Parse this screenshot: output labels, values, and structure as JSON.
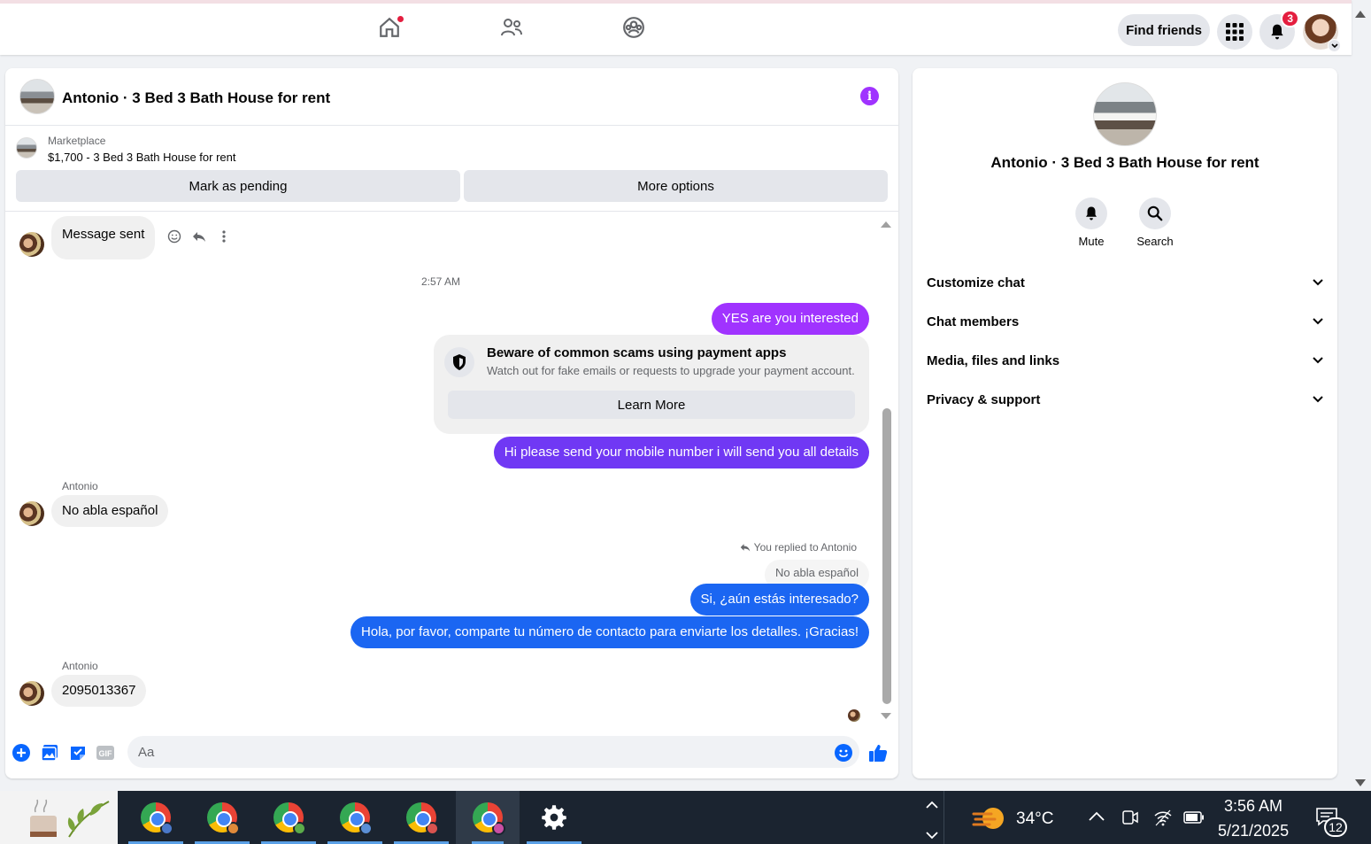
{
  "topnav": {
    "find_friends": "Find friends",
    "notification_count": "3"
  },
  "chat": {
    "title": "Antonio · 3 Bed 3 Bath House for rent",
    "marketplace_label": "Marketplace",
    "listing": "$1,700 - 3 Bed 3 Bath House for rent",
    "mark_pending": "Mark as pending",
    "more_options": "More options",
    "messages": {
      "m1": "Message sent",
      "timestamp": "2:57 AM",
      "m2": "YES are you interested",
      "scam_title": "Beware of common scams using payment apps",
      "scam_sub": "Watch out for fake emails or requests to upgrade your payment account.",
      "learn_more": "Learn More",
      "m3": "Hi please send your mobile number  i will send you all details",
      "sender1": "Antonio",
      "m4": "No abla español",
      "reply_note": "You replied to Antonio",
      "reply_quote": "No abla español",
      "m5": "Si, ¿aún estás interesado?",
      "m6": "Hola, por favor, comparte tu número de contacto para enviarte los detalles. ¡Gracias!",
      "sender2": "Antonio",
      "m7": "2095013367"
    },
    "composer_placeholder": "Aa"
  },
  "info": {
    "name": "Antonio · 3 Bed 3 Bath House for rent",
    "mute": "Mute",
    "search": "Search",
    "sections": [
      "Customize chat",
      "Chat members",
      "Media, files and links",
      "Privacy & support"
    ]
  },
  "taskbar": {
    "temperature": "34°C",
    "time": "3:56 AM",
    "date": "5/21/2025",
    "notif_count": "12"
  },
  "colors": {
    "accent_purple": "#a033ff",
    "accent_blue": "#1b66f2"
  }
}
